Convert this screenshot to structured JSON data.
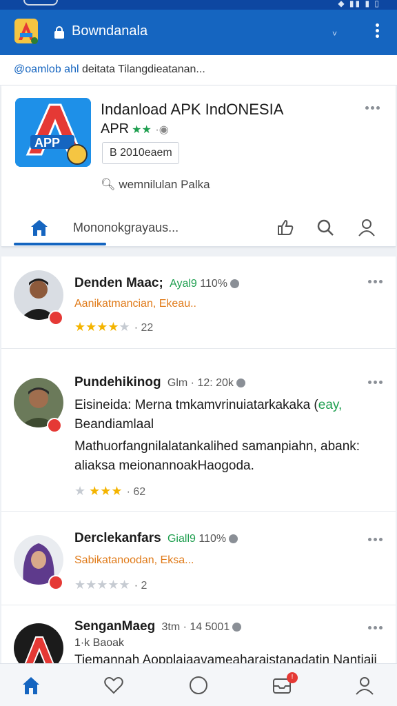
{
  "appbar": {
    "title": "Bowndanala"
  },
  "urlbar": {
    "prefix": "@oamlob ahl",
    "text": " deitata Tilangdieatanan..."
  },
  "app": {
    "title": "Indanload APK IndONESIA",
    "subtitle": "APR",
    "stars": "★★",
    "version": "B 2010eaem",
    "search_label": "wemnilulan Palka"
  },
  "tabs": {
    "label": "Mononokgrayaus..."
  },
  "posts": [
    {
      "name": "Denden Maac;",
      "meta_green": "Ayal9",
      "meta": "110%",
      "sub": "Aanikatmancian, Ekeau..",
      "stars_on": "★★★★",
      "stars_off": "★",
      "count": "· 22"
    },
    {
      "name": "Pundehikinog",
      "meta": "Glm · 12: 20k",
      "body_line1": "Eisineida: Merna tmkamvrinuiatarkakaka (",
      "body_line1_green": "eay,",
      "body_line2": "Beandiamlaal",
      "body_teal": "Mathuorfangnilalatankalihed samanpiahn, abank: aliaksa meionannoakHaogoda.",
      "stars_off": "★",
      "stars_on": "★★★",
      "count": "· 62"
    },
    {
      "name": "Derclekanfars",
      "meta_green": "Giall9",
      "meta": "110%",
      "sub": "Sabikatanoodan, Eksa...",
      "stars_off": "★★★★★",
      "count": "· 2"
    },
    {
      "name": "SenganMaeg",
      "meta": "3tm · 14 5001",
      "sub": "1·k Baoak",
      "body": "Tiemannah Aopplaiaavameaharaistanadatin Nantiaii"
    }
  ],
  "colors": {
    "primary": "#1565c0",
    "accent_green": "#1d9e4e",
    "star": "#f4b400",
    "badge": "#e53935"
  }
}
